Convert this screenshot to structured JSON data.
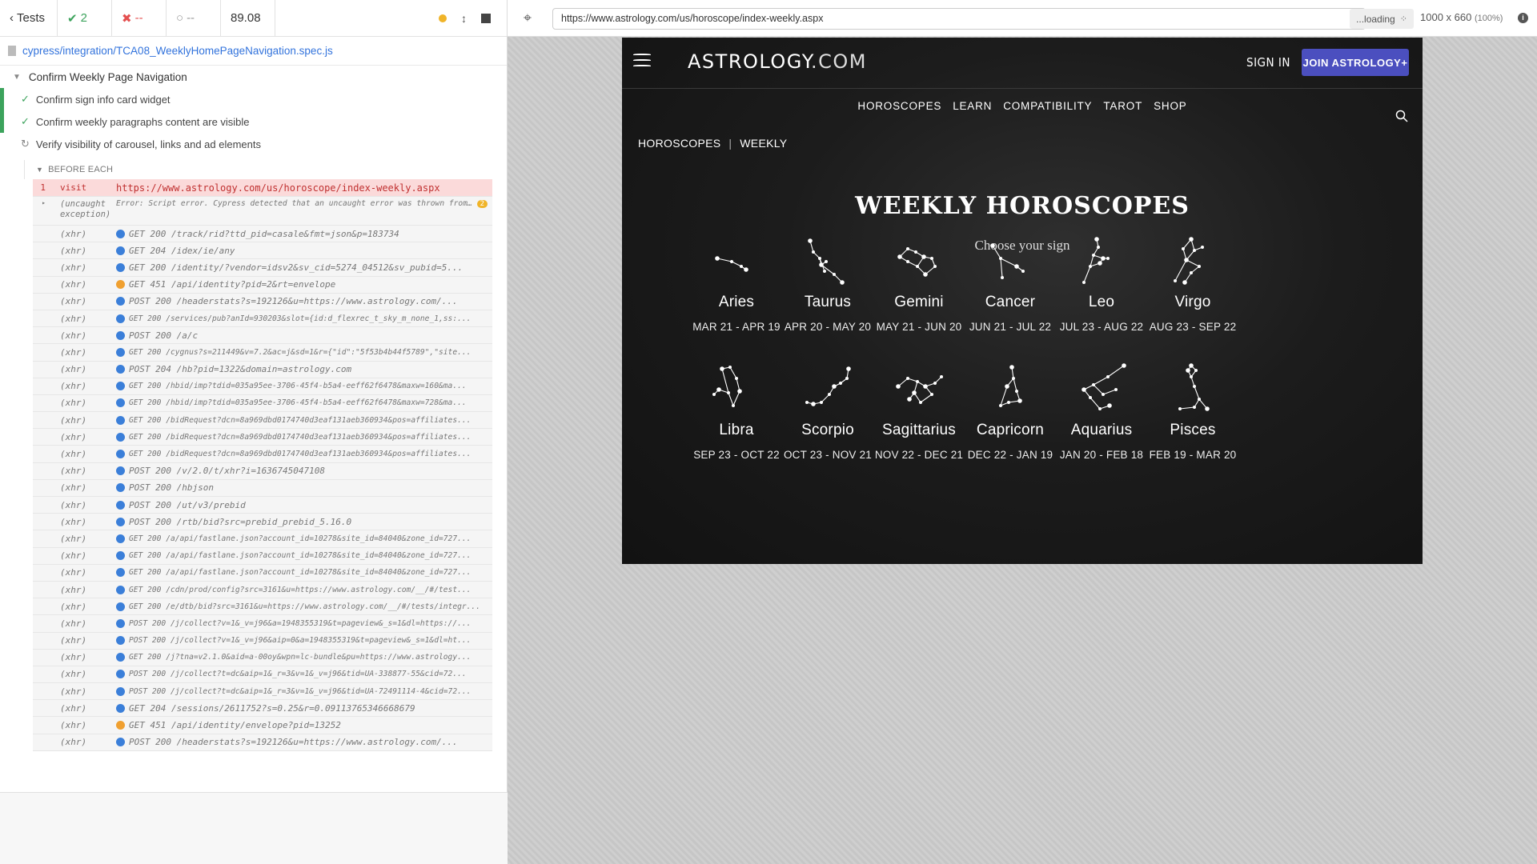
{
  "reporter": {
    "tests_label": "Tests",
    "passed": "2",
    "failed": "--",
    "pending": "--",
    "duration": "89.08",
    "spec_path": "cypress/integration/TCA08_WeeklyHomePageNavigation.spec.js",
    "suite": "Confirm Weekly Page Navigation",
    "tests": [
      {
        "title": "Confirm sign info card widget",
        "state": "passed"
      },
      {
        "title": "Confirm weekly paragraphs content are visible",
        "state": "passed"
      },
      {
        "title": "Verify visibility of carousel, links and ad elements",
        "state": "running"
      }
    ],
    "before_each": "BEFORE EACH",
    "visit": {
      "num": "1",
      "name": "visit",
      "msg": "https://www.astrology.com/us/horoscope/index-weekly.aspx"
    },
    "uncaught": {
      "name": "(uncaught exception)",
      "msg": "Error: Script error. Cypress detected that an uncaught error was thrown from a cross origin script.",
      "badge": "2"
    },
    "commands": [
      {
        "name": "(xhr)",
        "msg": "GET 200 /track/rid?ttd_pid=casale&fmt=json&p=183734",
        "dot": "blue",
        "small": false
      },
      {
        "name": "(xhr)",
        "msg": "GET 204 /idex/ie/any",
        "dot": "blue",
        "small": false
      },
      {
        "name": "(xhr)",
        "msg": "GET 200 /identity/?vendor=idsv2&sv_cid=5274_04512&sv_pubid=5...",
        "dot": "blue",
        "small": false
      },
      {
        "name": "(xhr)",
        "msg": "GET 451 /api/identity?pid=2&rt=envelope",
        "dot": "orange",
        "small": false
      },
      {
        "name": "(xhr)",
        "msg": "POST 200 /headerstats?s=192126&u=https://www.astrology.com/...",
        "dot": "blue",
        "small": false
      },
      {
        "name": "(xhr)",
        "msg": "GET 200 /services/pub?anId=930203&slot={id:d_flexrec_t_sky_m_none_1,ss:...",
        "dot": "blue",
        "small": true
      },
      {
        "name": "(xhr)",
        "msg": "POST 200 /a/c",
        "dot": "blue",
        "small": false
      },
      {
        "name": "(xhr)",
        "msg": "GET 200 /cygnus?s=211449&v=7.2&ac=j&sd=1&r={\"id\":\"5f53b4b44f5789\",\"site...",
        "dot": "blue",
        "small": true
      },
      {
        "name": "(xhr)",
        "msg": "POST 204 /hb?pid=1322&domain=astrology.com",
        "dot": "blue",
        "small": false
      },
      {
        "name": "(xhr)",
        "msg": "GET 200 /hbid/imp?tdid=035a95ee-3706-45f4-b5a4-eeff62f6478&maxw=160&ma...",
        "dot": "blue",
        "small": true
      },
      {
        "name": "(xhr)",
        "msg": "GET 200 /hbid/imp?tdid=035a95ee-3706-45f4-b5a4-eeff62f6478&maxw=728&ma...",
        "dot": "blue",
        "small": true
      },
      {
        "name": "(xhr)",
        "msg": "GET 200 /bidRequest?dcn=8a969dbd0174740d3eaf131aeb360934&pos=affiliates...",
        "dot": "blue",
        "small": true
      },
      {
        "name": "(xhr)",
        "msg": "GET 200 /bidRequest?dcn=8a969dbd0174740d3eaf131aeb360934&pos=affiliates...",
        "dot": "blue",
        "small": true
      },
      {
        "name": "(xhr)",
        "msg": "GET 200 /bidRequest?dcn=8a969dbd0174740d3eaf131aeb360934&pos=affiliates...",
        "dot": "blue",
        "small": true
      },
      {
        "name": "(xhr)",
        "msg": "POST 200 /v/2.0/t/xhr?i=1636745047108",
        "dot": "blue",
        "small": false
      },
      {
        "name": "(xhr)",
        "msg": "POST 200 /hbjson",
        "dot": "blue",
        "small": false
      },
      {
        "name": "(xhr)",
        "msg": "POST 200 /ut/v3/prebid",
        "dot": "blue",
        "small": false
      },
      {
        "name": "(xhr)",
        "msg": "POST 200 /rtb/bid?src=prebid_prebid_5.16.0",
        "dot": "blue",
        "small": false
      },
      {
        "name": "(xhr)",
        "msg": "GET 200 /a/api/fastlane.json?account_id=10278&site_id=84040&zone_id=727...",
        "dot": "blue",
        "small": true
      },
      {
        "name": "(xhr)",
        "msg": "GET 200 /a/api/fastlane.json?account_id=10278&site_id=84040&zone_id=727...",
        "dot": "blue",
        "small": true
      },
      {
        "name": "(xhr)",
        "msg": "GET 200 /a/api/fastlane.json?account_id=10278&site_id=84040&zone_id=727...",
        "dot": "blue",
        "small": true
      },
      {
        "name": "(xhr)",
        "msg": "GET 200 /cdn/prod/config?src=3161&u=https://www.astrology.com/__/#/test...",
        "dot": "blue",
        "small": true
      },
      {
        "name": "(xhr)",
        "msg": "GET 200 /e/dtb/bid?src=3161&u=https://www.astrology.com/__/#/tests/integr...",
        "dot": "blue",
        "small": true
      },
      {
        "name": "(xhr)",
        "msg": "POST 200 /j/collect?v=1&_v=j96&a=1948355319&t=pageview&_s=1&dl=https://...",
        "dot": "blue",
        "small": true
      },
      {
        "name": "(xhr)",
        "msg": "POST 200 /j/collect?v=1&_v=j96&aip=0&a=1948355319&t=pageview&_s=1&dl=ht...",
        "dot": "blue",
        "small": true
      },
      {
        "name": "(xhr)",
        "msg": "GET 200 /j?tna=v2.1.0&aid=a-00oy&wpn=lc-bundle&pu=https://www.astrology...",
        "dot": "blue",
        "small": true
      },
      {
        "name": "(xhr)",
        "msg": "POST 200 /j/collect?t=dc&aip=1&_r=3&v=1&_v=j96&tid=UA-338877-55&cid=72...",
        "dot": "blue",
        "small": true
      },
      {
        "name": "(xhr)",
        "msg": "POST 200 /j/collect?t=dc&aip=1&_r=3&v=1&_v=j96&tid=UA-72491114-4&cid=72...",
        "dot": "blue",
        "small": true
      },
      {
        "name": "(xhr)",
        "msg": "GET 204 /sessions/2611752?s=0.25&r=0.09113765346668679",
        "dot": "blue",
        "small": false
      },
      {
        "name": "(xhr)",
        "msg": "GET 451 /api/identity/envelope?pid=13252",
        "dot": "orange",
        "small": false
      },
      {
        "name": "(xhr)",
        "msg": "POST 200 /headerstats?s=192126&u=https://www.astrology.com/...",
        "dot": "blue",
        "small": false
      }
    ]
  },
  "aut": {
    "url": "https://www.astrology.com/us/horoscope/index-weekly.aspx",
    "loading": "...loading",
    "viewport": "1000 x 660",
    "zoom": "(100%)"
  },
  "site": {
    "logo_main": "ASTROLOGY",
    "logo_dot": ".COM",
    "sign_in": "SIGN IN",
    "join": "JOIN ASTROLOGY+",
    "nav": [
      "HOROSCOPES",
      "LEARN",
      "COMPATIBILITY",
      "TAROT",
      "SHOP"
    ],
    "breadcrumb": [
      "HOROSCOPES",
      "WEEKLY"
    ],
    "title": "WEEKLY HOROSCOPES",
    "subtitle": "Choose your sign",
    "signs": [
      {
        "name": "Aries",
        "dates": "MAR 21 - APR 19"
      },
      {
        "name": "Taurus",
        "dates": "APR 20 - MAY 20"
      },
      {
        "name": "Gemini",
        "dates": "MAY 21 - JUN 20"
      },
      {
        "name": "Cancer",
        "dates": "JUN 21 - JUL 22"
      },
      {
        "name": "Leo",
        "dates": "JUL 23 - AUG 22"
      },
      {
        "name": "Virgo",
        "dates": "AUG 23 - SEP 22"
      },
      {
        "name": "Libra",
        "dates": "SEP 23 - OCT 22"
      },
      {
        "name": "Scorpio",
        "dates": "OCT 23 - NOV 21"
      },
      {
        "name": "Sagittarius",
        "dates": "NOV 22 - DEC 21"
      },
      {
        "name": "Capricorn",
        "dates": "DEC 22 - JAN 19"
      },
      {
        "name": "Aquarius",
        "dates": "JAN 20 - FEB 18"
      },
      {
        "name": "Pisces",
        "dates": "FEB 19 - MAR 20"
      }
    ]
  }
}
